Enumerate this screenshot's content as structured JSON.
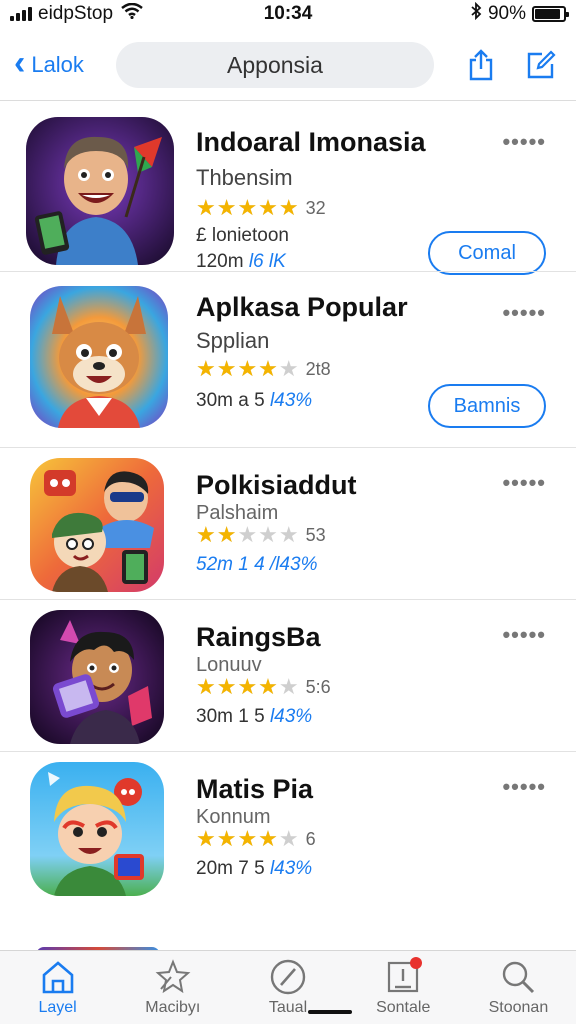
{
  "status_bar": {
    "carrier": "eidpStop",
    "time": "10:34",
    "battery_text": "90%",
    "battery_level": 0.9
  },
  "nav": {
    "back_label": "Lalok",
    "title": "Apponsia"
  },
  "apps": [
    {
      "name": "Indoaral Imonasia",
      "subtitle": "Thbensim",
      "rating": 5,
      "rating_count": "32",
      "extra": "£ lonietoon",
      "meta_plain": "120m ",
      "meta_highlight": "l6 lK",
      "button_label": "Comal"
    },
    {
      "name": "Aplkasa Popular",
      "subtitle": "Spplian",
      "rating": 4,
      "rating_count": "2t8",
      "meta_plain": "30m a 5 ",
      "meta_highlight": "l43%",
      "button_label": "Bamnis"
    },
    {
      "name": "Polkisiaddut",
      "subtitle": "Palshaim",
      "rating": 2,
      "rating_count": "53",
      "meta_plain": "",
      "meta_highlight": "52m 1 4 /l43%"
    },
    {
      "name": "RaingsBa",
      "subtitle": "Lonuuv",
      "rating": 4,
      "rating_count": "5:6",
      "meta_plain": "30m 1 5 ",
      "meta_highlight": "l43%"
    },
    {
      "name": "Matis Pia",
      "subtitle": "Konnum",
      "rating": 4,
      "rating_count": "6",
      "meta_plain": "20m 7 5 ",
      "meta_highlight": "l43%"
    }
  ],
  "tabs": [
    {
      "label": "Layel",
      "icon": "home-icon",
      "active": true
    },
    {
      "label": "Macibyı",
      "icon": "star-icon",
      "active": false
    },
    {
      "label": "Taual",
      "icon": "compass-icon",
      "active": false
    },
    {
      "label": "Sontale",
      "icon": "updates-icon",
      "active": false
    },
    {
      "label": "Stoonan",
      "icon": "search-icon",
      "active": false
    }
  ],
  "colors": {
    "accent": "#1a7cf0",
    "star": "#f4b400",
    "badge": "#e8322e"
  }
}
